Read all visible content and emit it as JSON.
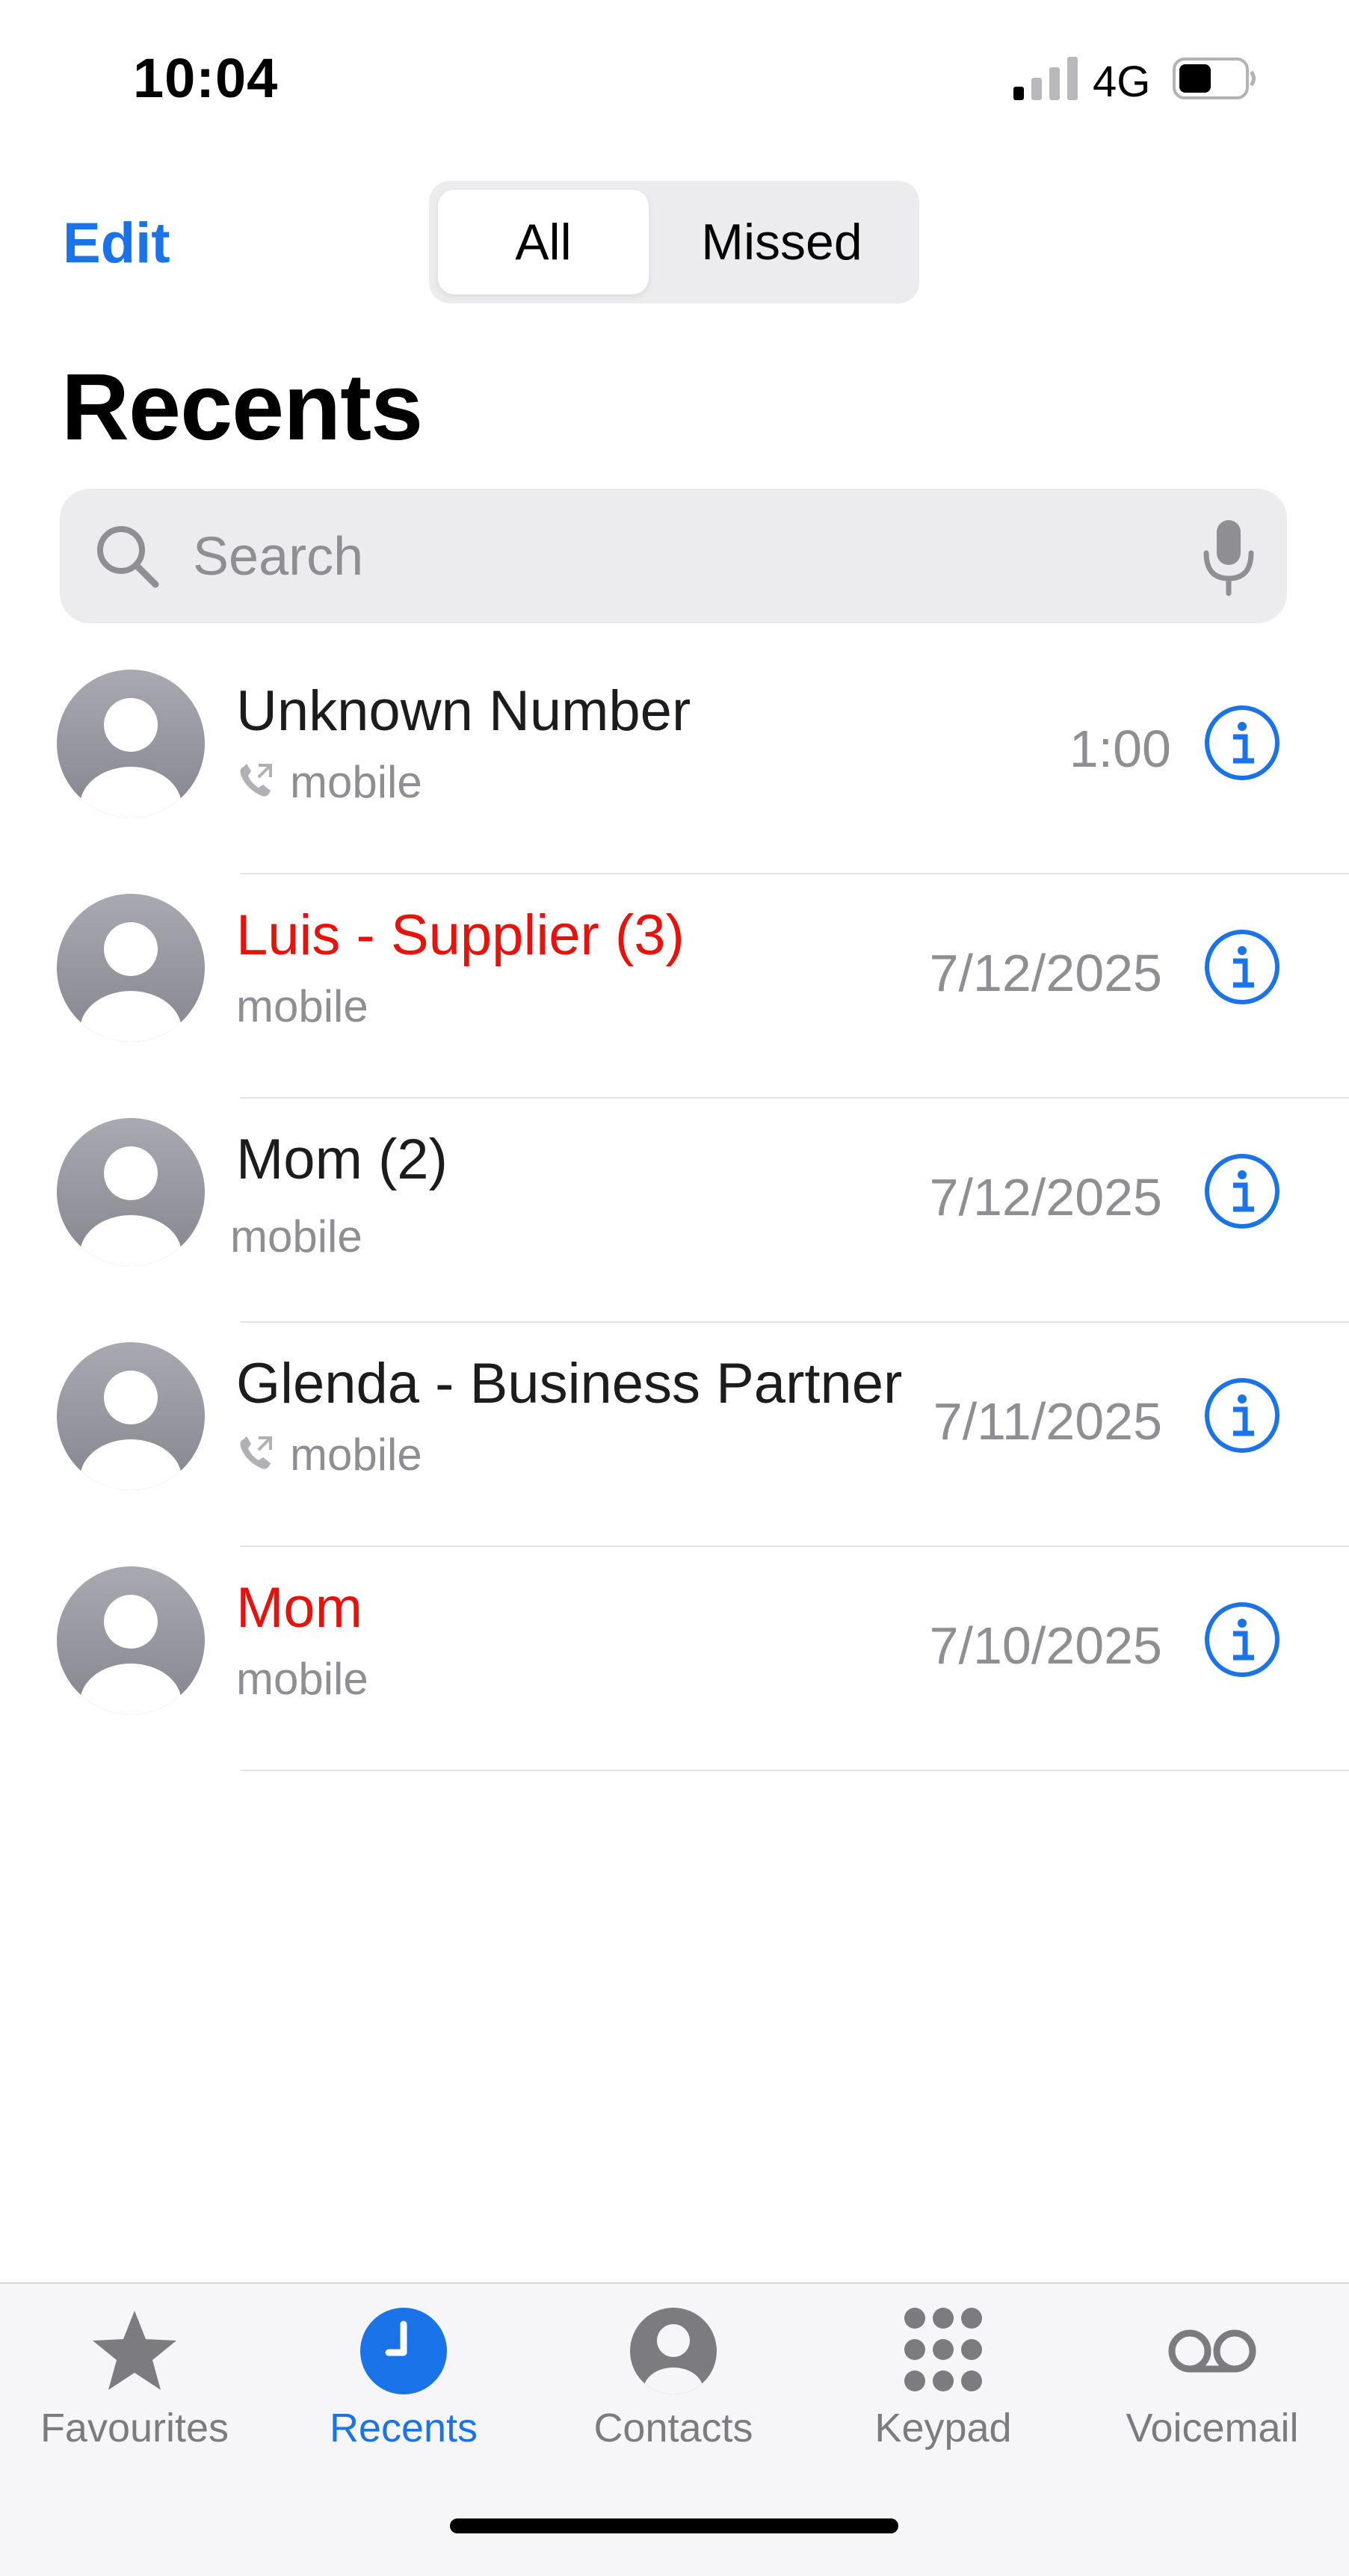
{
  "status_bar": {
    "time": "10:04",
    "network": "4G",
    "icons": [
      "signal-icon",
      "battery-icon"
    ]
  },
  "nav": {
    "edit_label": "Edit",
    "segments": [
      "All",
      "Missed"
    ],
    "selected_segment": "All"
  },
  "page": {
    "title": "Recents"
  },
  "search": {
    "placeholder": "Search",
    "value": "",
    "icons": [
      "search-icon",
      "mic-icon"
    ]
  },
  "calls": [
    {
      "name": "Unknown Number",
      "type": "mobile",
      "time": "1:00",
      "missed": false,
      "icon": "outgoing-call-icon"
    },
    {
      "name": "Luis - Supplier (3)",
      "type": "mobile",
      "time": "7/12/2025",
      "missed": true,
      "icon": ""
    },
    {
      "name": "Mom (2)",
      "type": "mobile",
      "time": "7/12/2025",
      "missed": false,
      "icon": ""
    },
    {
      "name": "Glenda - Business Partner",
      "type": "mobile",
      "time": "7/11/2025",
      "missed": false,
      "icon": "outgoing-call-icon"
    },
    {
      "name": "Mom",
      "type": "mobile",
      "time": "7/10/2025",
      "missed": true,
      "icon": ""
    }
  ],
  "tabs": [
    {
      "label": "Favourites",
      "icon": "star-icon",
      "active": false
    },
    {
      "label": "Recents",
      "icon": "clock-icon",
      "active": true
    },
    {
      "label": "Contacts",
      "icon": "person-circle-icon",
      "active": false
    },
    {
      "label": "Keypad",
      "icon": "keypad-icon",
      "active": false
    },
    {
      "label": "Voicemail",
      "icon": "voicemail-icon",
      "active": false
    }
  ],
  "colors": {
    "accent": "#1a73e8",
    "missed": "#e8120c",
    "secondary_text": "#8e8e93",
    "avatar": "#9a9aa3"
  }
}
